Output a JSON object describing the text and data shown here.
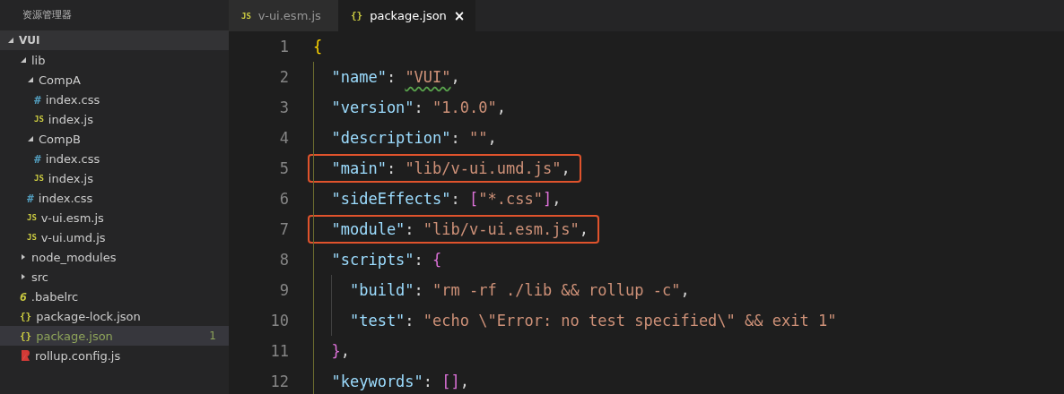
{
  "sidebar": {
    "title": "资源管理器",
    "tree": [
      {
        "label": "VUI",
        "kind": "root",
        "expanded": true,
        "selected": false,
        "children": [
          {
            "label": "lib",
            "kind": "folder",
            "expanded": true,
            "selected": false,
            "children": [
              {
                "label": "CompA",
                "kind": "folder",
                "expanded": true,
                "selected": false,
                "children": [
                  {
                    "label": "index.css",
                    "kind": "css",
                    "icon": "#",
                    "selected": false
                  },
                  {
                    "label": "index.js",
                    "kind": "js",
                    "icon": "JS",
                    "selected": false
                  }
                ]
              },
              {
                "label": "CompB",
                "kind": "folder",
                "expanded": true,
                "selected": false,
                "children": [
                  {
                    "label": "index.css",
                    "kind": "css",
                    "icon": "#",
                    "selected": false
                  },
                  {
                    "label": "index.js",
                    "kind": "js",
                    "icon": "JS",
                    "selected": false
                  }
                ]
              },
              {
                "label": "index.css",
                "kind": "css",
                "icon": "#",
                "selected": false
              },
              {
                "label": "v-ui.esm.js",
                "kind": "js",
                "icon": "JS",
                "selected": false
              },
              {
                "label": "v-ui.umd.js",
                "kind": "js",
                "icon": "JS",
                "selected": false
              }
            ]
          },
          {
            "label": "node_modules",
            "kind": "folder",
            "expanded": false,
            "selected": false
          },
          {
            "label": "src",
            "kind": "folder",
            "expanded": false,
            "selected": false
          },
          {
            "label": ".babelrc",
            "kind": "babel",
            "icon": "6",
            "selected": false
          },
          {
            "label": "package-lock.json",
            "kind": "json",
            "icon": "{}",
            "selected": false
          },
          {
            "label": "package.json",
            "kind": "json",
            "icon": "{}",
            "selected": true,
            "warning": true,
            "badge": "1"
          },
          {
            "label": "rollup.config.js",
            "kind": "rollup",
            "selected": false
          }
        ]
      }
    ]
  },
  "tabs": [
    {
      "label": "v-ui.esm.js",
      "kind": "js",
      "icon": "JS",
      "selected": false
    },
    {
      "label": "package.json",
      "kind": "json",
      "icon": "{}",
      "selected": true,
      "close": "×"
    }
  ],
  "editor": {
    "lines": [
      {
        "number": "1",
        "boxed": false,
        "tokens": [
          {
            "text": "{",
            "kind": "brace"
          }
        ]
      },
      {
        "number": "2",
        "boxed": false,
        "tokens": [
          {
            "text": "  \"name\"",
            "kind": "key"
          },
          {
            "text": ": ",
            "kind": "punct"
          },
          {
            "text": "\"VUI\"",
            "kind": "string",
            "warning": true
          },
          {
            "text": ",",
            "kind": "punct"
          }
        ]
      },
      {
        "number": "3",
        "boxed": false,
        "tokens": [
          {
            "text": "  \"version\"",
            "kind": "key"
          },
          {
            "text": ": ",
            "kind": "punct"
          },
          {
            "text": "\"1.0.0\"",
            "kind": "string"
          },
          {
            "text": ",",
            "kind": "punct"
          }
        ]
      },
      {
        "number": "4",
        "boxed": false,
        "tokens": [
          {
            "text": "  \"description\"",
            "kind": "key"
          },
          {
            "text": ": ",
            "kind": "punct"
          },
          {
            "text": "\"\"",
            "kind": "string"
          },
          {
            "text": ",",
            "kind": "punct"
          }
        ]
      },
      {
        "number": "5",
        "boxed": true,
        "tokens": [
          {
            "text": "  \"main\"",
            "kind": "key"
          },
          {
            "text": ": ",
            "kind": "punct"
          },
          {
            "text": "\"lib/v-ui.umd.js\"",
            "kind": "string"
          },
          {
            "text": ",",
            "kind": "punct"
          }
        ]
      },
      {
        "number": "6",
        "boxed": false,
        "tokens": [
          {
            "text": "  \"sideEffects\"",
            "kind": "key"
          },
          {
            "text": ": ",
            "kind": "punct"
          },
          {
            "text": "[",
            "kind": "bracket"
          },
          {
            "text": "\"*.css\"",
            "kind": "string"
          },
          {
            "text": "]",
            "kind": "bracket"
          },
          {
            "text": ",",
            "kind": "punct"
          }
        ]
      },
      {
        "number": "7",
        "boxed": true,
        "tokens": [
          {
            "text": "  \"module\"",
            "kind": "key"
          },
          {
            "text": ": ",
            "kind": "punct"
          },
          {
            "text": "\"lib/v-ui.esm.js\"",
            "kind": "string"
          },
          {
            "text": ",",
            "kind": "punct"
          }
        ]
      },
      {
        "number": "8",
        "boxed": false,
        "tokens": [
          {
            "text": "  \"scripts\"",
            "kind": "key"
          },
          {
            "text": ": ",
            "kind": "punct"
          },
          {
            "text": "{",
            "kind": "bracket"
          }
        ]
      },
      {
        "number": "9",
        "boxed": false,
        "tokens": [
          {
            "text": "    \"build\"",
            "kind": "key"
          },
          {
            "text": ": ",
            "kind": "punct"
          },
          {
            "text": "\"rm -rf ./lib && rollup -c\"",
            "kind": "string"
          },
          {
            "text": ",",
            "kind": "punct"
          }
        ]
      },
      {
        "number": "10",
        "boxed": false,
        "tokens": [
          {
            "text": "    \"test\"",
            "kind": "key"
          },
          {
            "text": ": ",
            "kind": "punct"
          },
          {
            "text": "\"echo \\\"Error: no test specified\\\" && exit 1\"",
            "kind": "string"
          }
        ]
      },
      {
        "number": "11",
        "boxed": false,
        "tokens": [
          {
            "text": "  }",
            "kind": "bracket"
          },
          {
            "text": ",",
            "kind": "punct"
          }
        ]
      },
      {
        "number": "12",
        "boxed": false,
        "tokens": [
          {
            "text": "  \"keywords\"",
            "kind": "key"
          },
          {
            "text": ": ",
            "kind": "punct"
          },
          {
            "text": "[]",
            "kind": "bracket"
          },
          {
            "text": ",",
            "kind": "punct"
          }
        ]
      }
    ]
  }
}
